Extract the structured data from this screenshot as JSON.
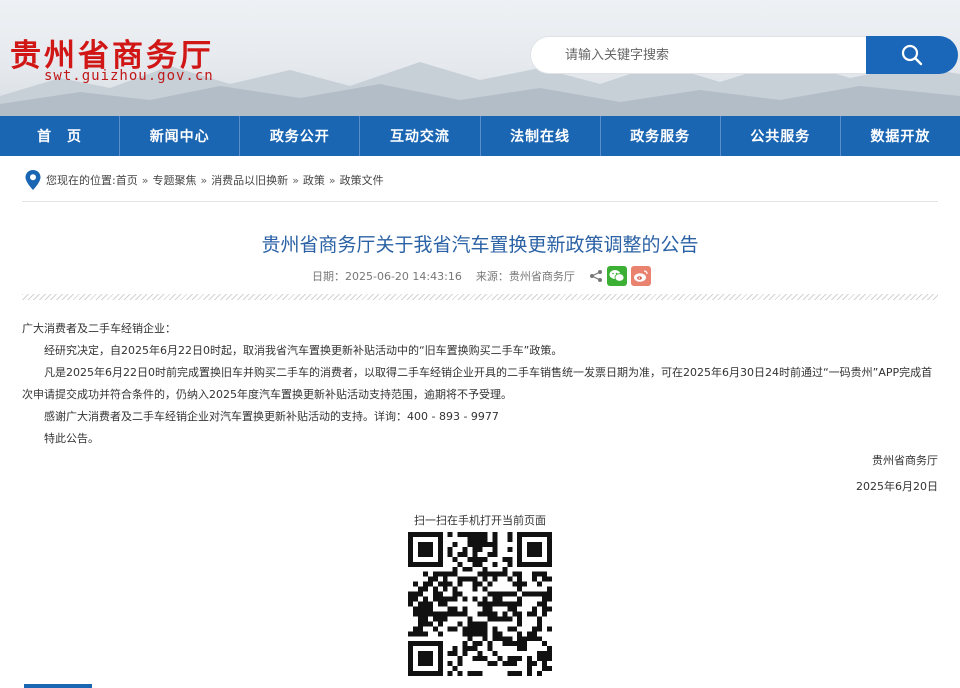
{
  "header": {
    "site_title": "贵州省商务厅",
    "site_url": "swt.guizhou.gov.cn",
    "search_placeholder": "请输入关键字搜索"
  },
  "nav": {
    "items": [
      "首　页",
      "新闻中心",
      "政务公开",
      "互动交流",
      "法制在线",
      "政务服务",
      "公共服务",
      "数据开放"
    ]
  },
  "breadcrumb": {
    "prefix": "您现在的位置:",
    "items": [
      "首页",
      "专题聚焦",
      "消费品以旧换新",
      "政策",
      "政策文件"
    ],
    "separator": "»"
  },
  "article": {
    "title": "贵州省商务厅关于我省汽车置换更新政策调整的公告",
    "date": "日期：2025-06-20 14:43:16",
    "source": "来源：贵州省商务厅",
    "salutation": "广大消费者及二手车经销企业：",
    "paragraphs": [
      "经研究决定，自2025年6月22日0时起，取消我省汽车置换更新补贴活动中的“旧车置换购买二手车”政策。",
      "凡是2025年6月22日0时前完成置换旧车并购买二手车的消费者，以取得二手车经销企业开具的二手车销售统一发票日期为准，可在2025年6月30日24时前通过“一码贵州”APP完成首次申请提交成功并符合条件的，仍纳入2025年度汽车置换更新补贴活动支持范围，逾期将不予受理。",
      "感谢广大消费者及二手车经销企业对汽车置换更新补贴活动的支持。详询：400 - 893 - 9977",
      "特此公告。"
    ],
    "signature": "贵州省商务厅",
    "sign_date": "2025年6月20日"
  },
  "qr": {
    "label": "扫一扫在手机打开当前页面"
  },
  "colors": {
    "brand_blue": "#1a66b3",
    "title_red": "#d11616",
    "title_blue": "#2b62a5",
    "wechat_green": "#3cb034",
    "weibo_orange": "#e9826e"
  },
  "icons": [
    "search-icon",
    "location-pin-icon",
    "share-icon",
    "wechat-icon",
    "weibo-icon",
    "qr-code-icon"
  ]
}
